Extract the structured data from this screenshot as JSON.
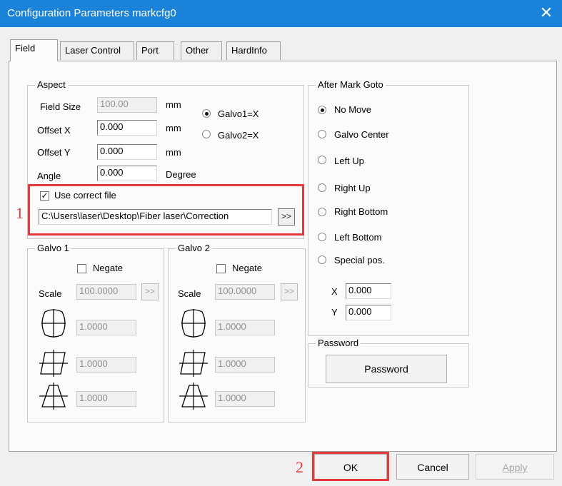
{
  "window": {
    "title": "Configuration Parameters markcfg0",
    "close_glyph": "✕"
  },
  "tabs": [
    {
      "label": "Field",
      "active": true
    },
    {
      "label": "Laser Control"
    },
    {
      "label": "Port"
    },
    {
      "label": "Other"
    },
    {
      "label": "HardInfo"
    }
  ],
  "aspect": {
    "title": "Aspect",
    "field_size": {
      "label": "Field Size",
      "value": "100.00",
      "unit": "mm"
    },
    "offset_x": {
      "label": "Offset X",
      "value": "0.000",
      "unit": "mm"
    },
    "offset_y": {
      "label": "Offset Y",
      "value": "0.000",
      "unit": "mm"
    },
    "angle": {
      "label": "Angle",
      "value": "0.000",
      "unit": "Degree"
    },
    "galvo1": {
      "label": "Galvo1=X",
      "checked": true
    },
    "galvo2": {
      "label": "Galvo2=X",
      "checked": false
    },
    "use_correct_file": {
      "label": "Use correct file",
      "checked": true,
      "check_glyph": "✓"
    },
    "correction_path": "C:\\Users\\laser\\Desktop\\Fiber laser\\Correction",
    "browse_label": ">>"
  },
  "galvo1": {
    "title": "Galvo 1",
    "negate_label": "Negate",
    "scale_label": "Scale",
    "scale_value": "100.0000",
    "scale_btn": ">>",
    "barrel_value": "1.0000",
    "parallelogram_value": "1.0000",
    "trapezoid_value": "1.0000"
  },
  "galvo2": {
    "title": "Galvo 2",
    "negate_label": "Negate",
    "scale_label": "Scale",
    "scale_value": "100.0000",
    "scale_btn": ">>",
    "barrel_value": "1.0000",
    "parallelogram_value": "1.0000",
    "trapezoid_value": "1.0000"
  },
  "after_mark": {
    "title": "After Mark Goto",
    "options": [
      {
        "label": "No Move",
        "checked": true
      },
      {
        "label": "Galvo Center"
      },
      {
        "label": "Left Up"
      },
      {
        "label": "Right Up"
      },
      {
        "label": "Right Bottom"
      },
      {
        "label": "Left Bottom"
      },
      {
        "label": "Special pos."
      }
    ],
    "x_label": "X",
    "x_value": "0.000",
    "y_label": "Y",
    "y_value": "0.000"
  },
  "password": {
    "title": "Password",
    "button": "Password"
  },
  "footer": {
    "ok": "OK",
    "cancel": "Cancel",
    "apply": "Apply"
  },
  "annotations": {
    "marker1": "1",
    "marker2": "2"
  },
  "colors": {
    "titlebar": "#1a82d9",
    "highlight": "#e33b3b"
  }
}
